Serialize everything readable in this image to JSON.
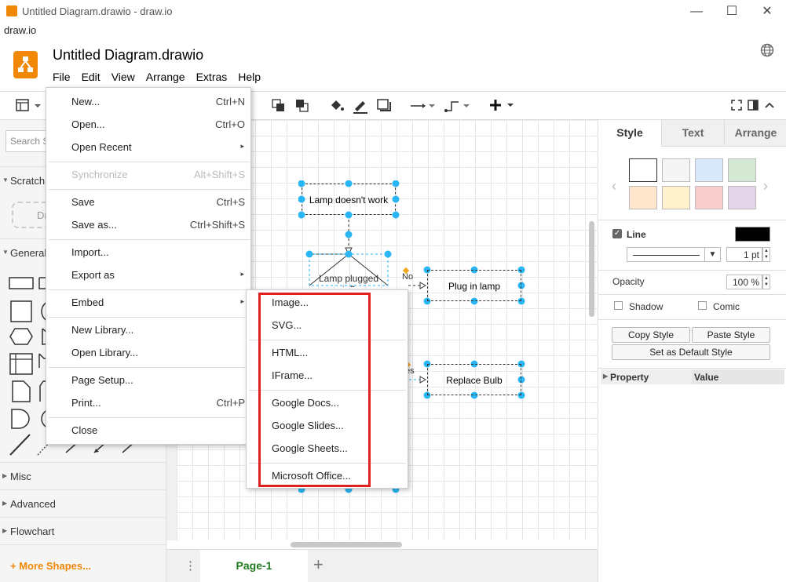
{
  "window": {
    "title": "Untitled Diagram.drawio - draw.io",
    "minimize": "—",
    "maximize": "☐",
    "close": "✕",
    "app_menu": "draw.io"
  },
  "header": {
    "doc_title": "Untitled Diagram.drawio",
    "menus": [
      "File",
      "Edit",
      "View",
      "Arrange",
      "Extras",
      "Help"
    ]
  },
  "left_panel": {
    "search_placeholder": "Search S",
    "scratchpad": "Scratch",
    "scratch_drop": "Dr",
    "general": "General",
    "misc": "Misc",
    "advanced": "Advanced",
    "flowchart": "Flowchart",
    "more_shapes": "+ More Shapes..."
  },
  "diagram": {
    "start": "Lamp doesn't work",
    "decision": "Lamp plugged in?",
    "no_label": "No",
    "yes_label": "es",
    "plug_in": "Plug in lamp",
    "replace": "Replace Bulb"
  },
  "file_menu": {
    "items": [
      {
        "label": "New...",
        "shortcut": "Ctrl+N"
      },
      {
        "label": "Open...",
        "shortcut": "Ctrl+O"
      },
      {
        "label": "Open Recent",
        "submenu": "▸"
      },
      {
        "label": "Synchronize",
        "shortcut": "Alt+Shift+S",
        "disabled": true
      },
      {
        "label": "Save",
        "shortcut": "Ctrl+S"
      },
      {
        "label": "Save as...",
        "shortcut": "Ctrl+Shift+S"
      },
      {
        "label": "Import..."
      },
      {
        "label": "Export as",
        "submenu": "▸"
      },
      {
        "label": "Embed",
        "submenu": "▸"
      },
      {
        "label": "New Library..."
      },
      {
        "label": "Open Library..."
      },
      {
        "label": "Page Setup..."
      },
      {
        "label": "Print...",
        "shortcut": "Ctrl+P"
      },
      {
        "label": "Close"
      }
    ]
  },
  "embed_menu": {
    "items": [
      "Image...",
      "SVG...",
      "HTML...",
      "IFrame...",
      "Google Docs...",
      "Google Slides...",
      "Google Sheets...",
      "Microsoft Office..."
    ]
  },
  "right_panel": {
    "tabs": [
      "Style",
      "Text",
      "Arrange"
    ],
    "swatches": [
      "#ffffff",
      "#f5f5f5",
      "#dae8fc",
      "#d5e8d4",
      "#ffe6cc",
      "#fff2cc",
      "#f8cecc",
      "#e1d5e7"
    ],
    "line_label": "Line",
    "line_width": "1 pt",
    "opacity_label": "Opacity",
    "opacity_value": "100 %",
    "shadow": "Shadow",
    "comic": "Comic",
    "copy_style": "Copy Style",
    "paste_style": "Paste Style",
    "default_style": "Set as Default Style",
    "property": "Property",
    "value": "Value"
  },
  "pages": {
    "tab": "Page-1",
    "add": "+",
    "menu": "⋮"
  }
}
